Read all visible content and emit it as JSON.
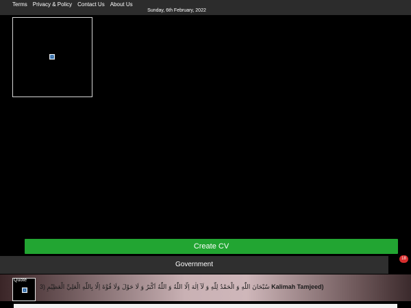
{
  "header": {
    "nav": [
      "Terms",
      "Privacy & Policy",
      "Contact Us",
      "About Us"
    ],
    "date": "Sunday, 6th February, 2022"
  },
  "main": {
    "ad_image_icon": "broken-image-icon",
    "create_cv_label": "Create CV",
    "government_label": "Government",
    "notification_count": "18"
  },
  "quote": {
    "label": "Quote",
    "prefix": "3)",
    "arabic": "سُبْحَانَ اللّٰهِ وَ الْحَمْدُ لِلّٰهِ وَ لَآ اِلٰهَ اِلَّا اللّٰهُ وَ اللّٰهُ اَكْبَرُ وَ لَا حَوْلَ وَلَا قُوَّةَ اِلَّا بِاللّٰهِ الْعَلِيِّ الْعَظِيْمِ",
    "title": "Kalimah Tamjeed)"
  },
  "colors": {
    "background": "#000000",
    "topbar": "#2c2c2c",
    "create_cv": "#22a532",
    "government_bar": "#2f2f2f",
    "badge": "#d62e2e"
  }
}
